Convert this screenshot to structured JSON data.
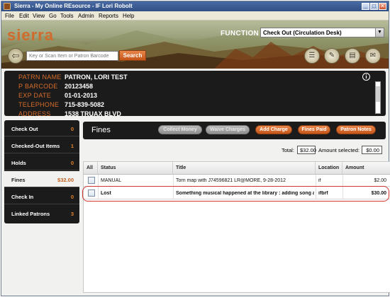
{
  "window": {
    "title": "Sierra - My Online REsource - IF Lori Robolt",
    "controls": {
      "minimize": "_",
      "maximize": "□",
      "close": "✕"
    }
  },
  "menu": [
    "File",
    "Edit",
    "View",
    "Go",
    "Tools",
    "Admin",
    "Reports",
    "Help"
  ],
  "banner": {
    "logo": "sierra",
    "function_label": "FUNCTION",
    "function_value": "Check Out (Circulation Desk)",
    "search_placeholder": "Key or Scan Item or Patron Barcode",
    "search_button": "Search",
    "tool_icons": [
      "checkout-list-icon",
      "receipt-icon",
      "print-icon",
      "chat-settings-icon"
    ]
  },
  "patron": {
    "fields": [
      {
        "label": "PATRN NAME",
        "value": "PATRON, LORI TEST"
      },
      {
        "label": "P BARCODE",
        "value": "20123458"
      },
      {
        "label": "EXP DATE",
        "value": "01-01-2013"
      },
      {
        "label": "TELEPHONE",
        "value": "715-839-5082"
      },
      {
        "label": "ADDRESS",
        "value": "1538 TRUAX BLVD"
      }
    ]
  },
  "sidebar": {
    "items": [
      {
        "label": "Check Out",
        "count": "0",
        "active": false
      },
      {
        "label": "Checked-Out Items",
        "count": "1",
        "active": false
      },
      {
        "label": "Holds",
        "count": "0",
        "active": false
      },
      {
        "label": "Fines",
        "count": "$32.00",
        "active": true
      },
      {
        "label": "Check In",
        "count": "0",
        "active": false
      },
      {
        "label": "Linked Patrons",
        "count": "3",
        "active": false
      }
    ]
  },
  "fines": {
    "title": "Fines",
    "buttons": [
      {
        "label": "Collect Money",
        "enabled": false
      },
      {
        "label": "Waive Charges",
        "enabled": false
      },
      {
        "label": "Add Charge",
        "enabled": true
      },
      {
        "label": "Fines Paid",
        "enabled": true
      },
      {
        "label": "Patron Notes",
        "enabled": true
      }
    ],
    "total_label": "Total:",
    "total_value": "$32.00",
    "selected_label": "Amount selected:",
    "selected_value": "$0.00",
    "columns": [
      "All",
      "Status",
      "Title",
      "Location",
      "Amount"
    ],
    "rows": [
      {
        "status": "MANUAL",
        "title": "Torn map with J74596821 LR@MORE, 9-28-2012",
        "location": "if",
        "amount": "$2.00"
      },
      {
        "status": "Lost",
        "title": "Something musical happened at the library : adding song a...",
        "location": "ifbrf",
        "amount": "$30.00"
      }
    ]
  },
  "colors": {
    "accent": "#d06b2c",
    "panel": "#1b1b1b",
    "highlight": "#d0352f"
  }
}
